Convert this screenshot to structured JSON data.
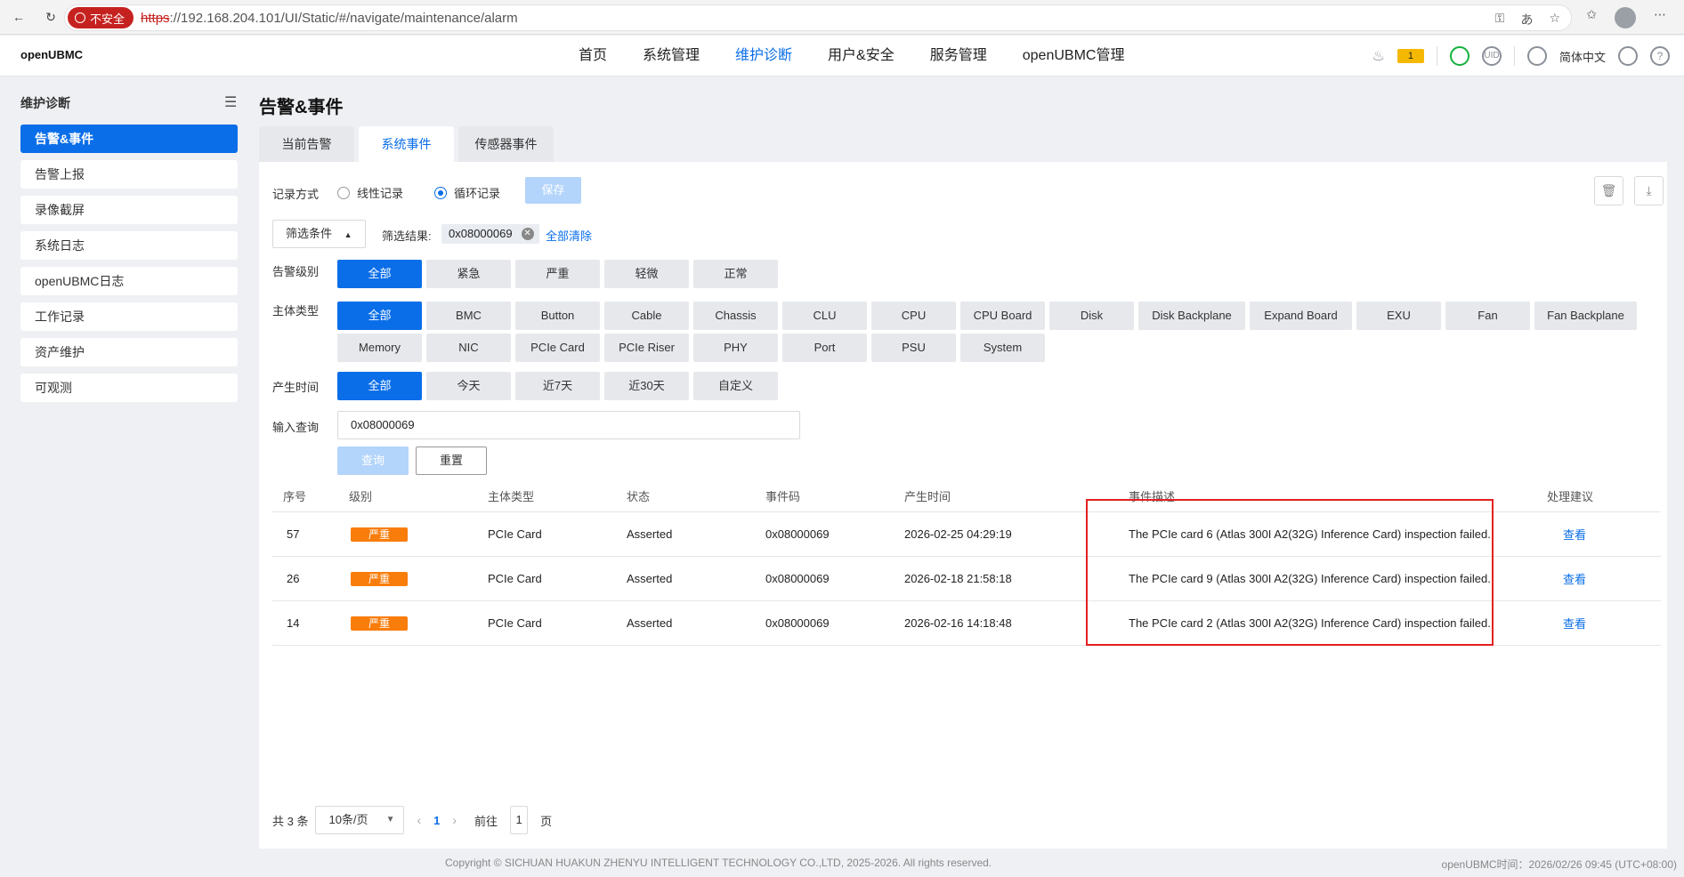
{
  "browser": {
    "insecure_label": "不安全",
    "url_scheme": "https",
    "url_rest": "://192.168.204.101/UI/Static/#/navigate/maintenance/alarm"
  },
  "header": {
    "brand": "openUBMC",
    "nav": [
      "首页",
      "系统管理",
      "维护诊断",
      "用户&安全",
      "服务管理",
      "openUBMC管理"
    ],
    "alarm_count": "1",
    "uid_label": "UID",
    "language": "简体中文"
  },
  "sidebar": {
    "title": "维护诊断",
    "items": [
      "告警&事件",
      "告警上报",
      "录像截屏",
      "系统日志",
      "openUBMC日志",
      "工作记录",
      "资产维护",
      "可观测"
    ]
  },
  "main": {
    "title": "告警&事件",
    "tabs": [
      "当前告警",
      "系统事件",
      "传感器事件"
    ],
    "record_mode_label": "记录方式",
    "radio_linear": "线性记录",
    "radio_cyclic": "循环记录",
    "save_label": "保存",
    "filter_dropdown": "筛选条件",
    "filter_result_label": "筛选结果:",
    "filter_chip": "0x08000069",
    "clear_all": "全部清除",
    "level_label": "告警级别",
    "levels": [
      "全部",
      "紧急",
      "严重",
      "轻微",
      "正常"
    ],
    "subject_label": "主体类型",
    "subjects_row1": [
      "全部",
      "BMC",
      "Button",
      "Cable",
      "Chassis",
      "CLU",
      "CPU",
      "CPU Board",
      "Disk",
      "Disk Backplane",
      "Expand Board",
      "EXU",
      "Fan",
      "Fan Backplane"
    ],
    "subjects_row2": [
      "Memory",
      "NIC",
      "PCIe Card",
      "PCIe Riser",
      "PHY",
      "Port",
      "PSU",
      "System"
    ],
    "time_label": "产生时间",
    "times": [
      "全部",
      "今天",
      "近7天",
      "近30天",
      "自定义"
    ],
    "query_label": "输入查询",
    "query_value": "0x08000069",
    "query_button": "查询",
    "reset_button": "重置"
  },
  "table": {
    "columns": [
      "序号",
      "级别",
      "主体类型",
      "状态",
      "事件码",
      "产生时间",
      "事件描述",
      "处理建议"
    ],
    "rows": [
      {
        "no": "57",
        "level": "严重",
        "subject": "PCIe Card",
        "status": "Asserted",
        "code": "0x08000069",
        "time": "2026-02-25 04:29:19",
        "desc": "The PCIe card 6 (Atlas 300I A2(32G) Inference Card) inspection failed.",
        "action": "查看"
      },
      {
        "no": "26",
        "level": "严重",
        "subject": "PCIe Card",
        "status": "Asserted",
        "code": "0x08000069",
        "time": "2026-02-18 21:58:18",
        "desc": "The PCIe card 9 (Atlas 300I A2(32G) Inference Card) inspection failed.",
        "action": "查看"
      },
      {
        "no": "14",
        "level": "严重",
        "subject": "PCIe Card",
        "status": "Asserted",
        "code": "0x08000069",
        "time": "2026-02-16 14:18:48",
        "desc": "The PCIe card 2 (Atlas 300I A2(32G) Inference Card) inspection failed.",
        "action": "查看"
      }
    ]
  },
  "pager": {
    "total": "共 3 条",
    "page_size": "10条/页",
    "current": "1",
    "goto": "前往",
    "goto_value": "1",
    "suffix": "页"
  },
  "footer": {
    "copyright": "Copyright © SICHUAN HUAKUN ZHENYU INTELLIGENT TECHNOLOGY CO.,LTD, 2025-2026. All rights reserved.",
    "time": "openUBMC时间：2026/02/26 09:45 (UTC+08:00)"
  },
  "colors": {
    "accent": "#0a6ee8",
    "severity": "#f97d0b",
    "highlight": "#e32020"
  }
}
